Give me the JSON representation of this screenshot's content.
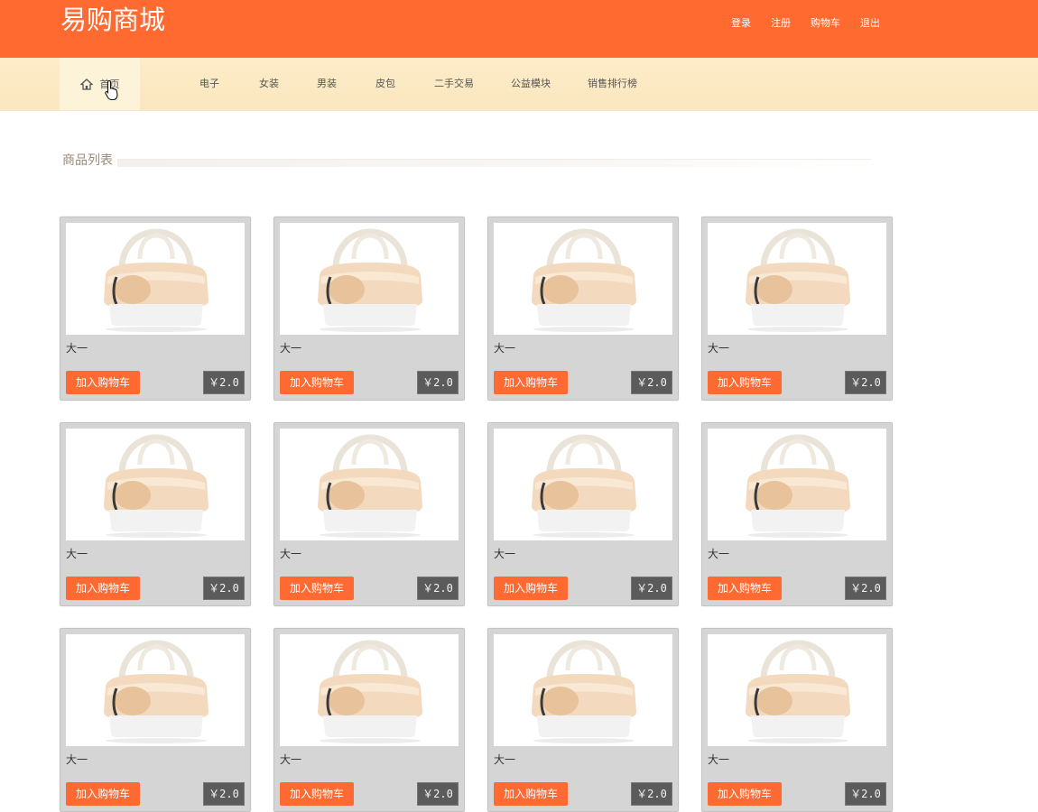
{
  "header": {
    "title": "易购商城",
    "links": [
      "登录",
      "注册",
      "购物车",
      "退出"
    ]
  },
  "nav": {
    "home": "首页",
    "items": [
      "电子",
      "女装",
      "男装",
      "皮包",
      "二手交易",
      "公益模块",
      "销售排行榜"
    ]
  },
  "section": {
    "title": "商品列表"
  },
  "products": [
    {
      "name": "大一",
      "add_label": "加入购物车",
      "price": "￥2.0"
    },
    {
      "name": "大一",
      "add_label": "加入购物车",
      "price": "￥2.0"
    },
    {
      "name": "大一",
      "add_label": "加入购物车",
      "price": "￥2.0"
    },
    {
      "name": "大一",
      "add_label": "加入购物车",
      "price": "￥2.0"
    },
    {
      "name": "大一",
      "add_label": "加入购物车",
      "price": "￥2.0"
    },
    {
      "name": "大一",
      "add_label": "加入购物车",
      "price": "￥2.0"
    },
    {
      "name": "大一",
      "add_label": "加入购物车",
      "price": "￥2.0"
    },
    {
      "name": "大一",
      "add_label": "加入购物车",
      "price": "￥2.0"
    },
    {
      "name": "大一",
      "add_label": "加入购物车",
      "price": "￥2.0"
    },
    {
      "name": "大一",
      "add_label": "加入购物车",
      "price": "￥2.0"
    },
    {
      "name": "大一",
      "add_label": "加入购物车",
      "price": "￥2.0"
    },
    {
      "name": "大一",
      "add_label": "加入购物车",
      "price": "￥2.0"
    }
  ],
  "colors": {
    "header_bg": "#fe6a30",
    "nav_bg": "#fbe7bf",
    "button_bg": "#ff6a32",
    "price_bg": "#5b5b5b"
  },
  "icons": {
    "home": "home-icon",
    "cursor": "hand-cursor-icon",
    "product_image": "handbag-image"
  }
}
